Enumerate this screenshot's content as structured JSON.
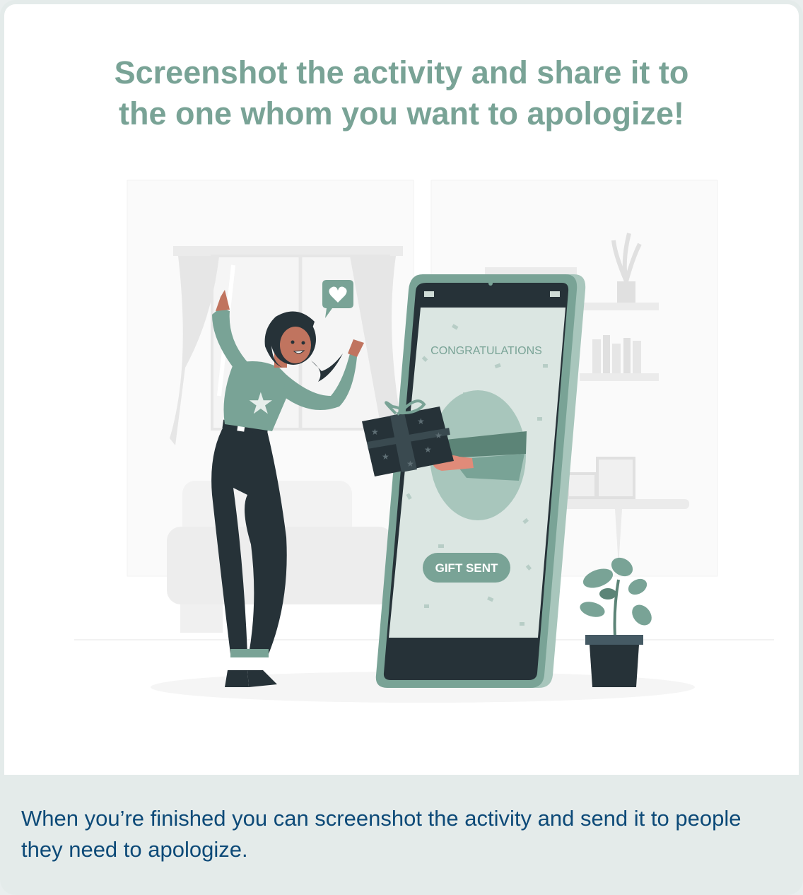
{
  "header": {
    "title_line1": "Screenshot the activity and share it to",
    "title_line2": "the one whom you want to apologize!"
  },
  "illustration": {
    "phone_heading": "CONGRATULATIONS",
    "phone_button": "GIFT SENT"
  },
  "footer": {
    "instruction": "When you’re finished you can screenshot the activity and send it to people they need to apologize."
  },
  "colors": {
    "accent": "#79a396",
    "footer_text": "#0d4a78",
    "dark": "#263238",
    "footer_bg": "#e4ebea"
  }
}
